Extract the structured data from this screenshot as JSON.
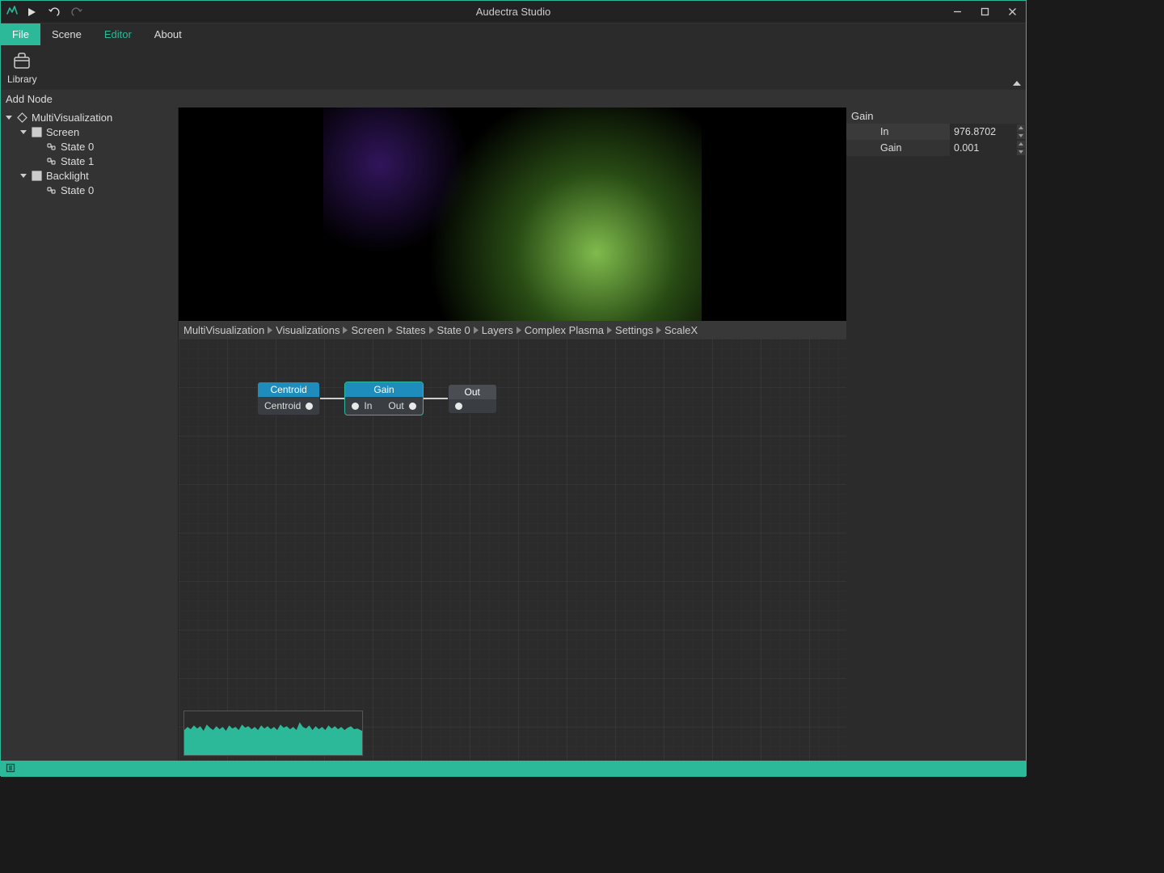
{
  "app": {
    "title": "Audectra Studio"
  },
  "menu": {
    "file": "File",
    "scene": "Scene",
    "editor": "Editor",
    "about": "About"
  },
  "ribbon": {
    "library": "Library",
    "section": "Add Node"
  },
  "tree": {
    "root": "MultiVisualization",
    "screen": "Screen",
    "state0": "State 0",
    "state1": "State 1",
    "backlight": "Backlight",
    "bl_state0": "State 0"
  },
  "breadcrumb": {
    "b0": "MultiVisualization",
    "b1": "Visualizations",
    "b2": "Screen",
    "b3": "States",
    "b4": "State 0",
    "b5": "Layers",
    "b6": "Complex Plasma",
    "b7": "Settings",
    "b8": "ScaleX"
  },
  "nodes": {
    "centroid": {
      "title": "Centroid",
      "out": "Centroid"
    },
    "gain": {
      "title": "Gain",
      "in": "In",
      "out": "Out"
    },
    "out": {
      "title": "Out"
    }
  },
  "props": {
    "header": "Gain",
    "rows": {
      "in": {
        "label": "In",
        "value": "976.8702"
      },
      "gain": {
        "label": "Gain",
        "value": "0.001"
      }
    }
  }
}
